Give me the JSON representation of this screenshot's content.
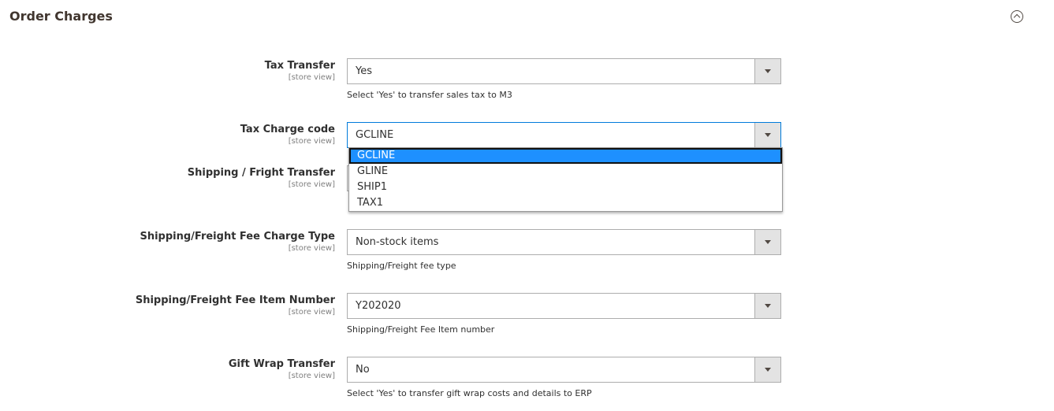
{
  "section": {
    "title": "Order Charges",
    "collapse_icon": "chevron-up-circle-icon"
  },
  "fields": [
    {
      "label": "Tax Transfer",
      "scope": "[store view]",
      "value": "Yes",
      "note": "Select 'Yes' to transfer sales tax to M3"
    },
    {
      "label": "Tax Charge code",
      "scope": "[store view]",
      "value": "GCLINE",
      "note": ""
    },
    {
      "label": "Shipping / Fright Transfer",
      "scope": "[store view]",
      "value": "",
      "note": ""
    },
    {
      "label": "Shipping/Freight Fee Charge Type",
      "scope": "[store view]",
      "value": "Non-stock items",
      "note": "Shipping/Freight fee type"
    },
    {
      "label": "Shipping/Freight Fee Item Number",
      "scope": "[store view]",
      "value": "Y202020",
      "note": "Shipping/Freight Fee Item number"
    },
    {
      "label": "Gift Wrap Transfer",
      "scope": "[store view]",
      "value": "No",
      "note": "Select 'Yes' to transfer gift wrap costs and details to ERP"
    }
  ],
  "dropdown": {
    "options": [
      "GCLINE",
      "GLINE",
      "SHIP1",
      "TAX1"
    ],
    "selected": "GCLINE",
    "highlight_color": "#1e90ff"
  }
}
